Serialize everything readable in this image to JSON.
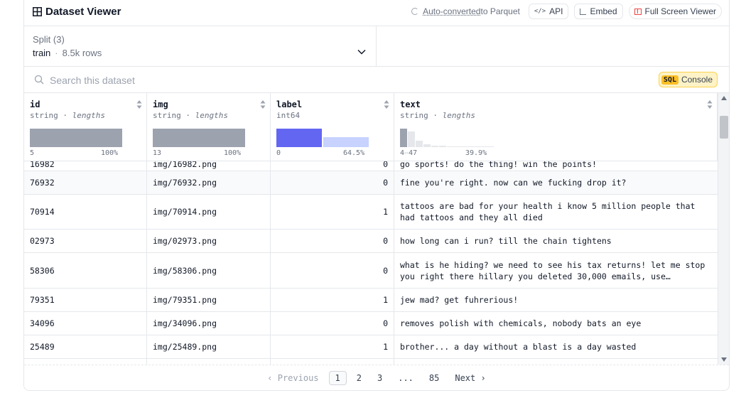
{
  "header": {
    "title": "Dataset Viewer",
    "auto_converted": "Auto-converted",
    "to_parquet": " to Parquet",
    "api_label": "API",
    "embed_label": "Embed",
    "full_screen_label": "Full Screen Viewer"
  },
  "split": {
    "label": "Split (3)",
    "value": "train",
    "rows": "8.5k rows"
  },
  "search": {
    "placeholder": "Search this dataset"
  },
  "sql": {
    "tag": "SQL",
    "label": "Console"
  },
  "columns": [
    {
      "name": "id",
      "type": "string",
      "type_extra": "lengths",
      "min": "5",
      "max": "100%"
    },
    {
      "name": "img",
      "type": "string",
      "type_extra": "lengths",
      "min": "13",
      "max": "100%"
    },
    {
      "name": "label",
      "type": "int64",
      "type_extra": "",
      "min": "0",
      "max": "64.5%"
    },
    {
      "name": "text",
      "type": "string",
      "type_extra": "lengths",
      "min": "4",
      "min_suffix": "47",
      "max": "39.9%"
    }
  ],
  "rows": [
    {
      "id": "16982",
      "img": "img/16982.png",
      "label": "0",
      "text": "go sports! do the thing! win the points!"
    },
    {
      "id": "76932",
      "img": "img/76932.png",
      "label": "0",
      "text": "fine you're right. now can we fucking drop it?"
    },
    {
      "id": "70914",
      "img": "img/70914.png",
      "label": "1",
      "text": "tattoos are bad for your health i know 5 million people that had tattoos and they all died"
    },
    {
      "id": "02973",
      "img": "img/02973.png",
      "label": "0",
      "text": "how long can i run? till the chain tightens"
    },
    {
      "id": "58306",
      "img": "img/58306.png",
      "label": "0",
      "text": "what is he hiding? we need to see his tax returns! let me stop you right there hillary you deleted 30,000 emails, use…"
    },
    {
      "id": "79351",
      "img": "img/79351.png",
      "label": "1",
      "text": "jew mad? get fuhrerious!"
    },
    {
      "id": "34096",
      "img": "img/34096.png",
      "label": "0",
      "text": "removes polish with chemicals, nobody bats an eye"
    },
    {
      "id": "25489",
      "img": "img/25489.png",
      "label": "1",
      "text": "brother... a day without a blast is a day wasted"
    }
  ],
  "pagination": {
    "previous": "‹ Previous",
    "pages": [
      "1",
      "2",
      "3",
      "...",
      "85"
    ],
    "next": "Next ›",
    "current": "1"
  },
  "colors": {
    "accent_histogram": "#6366f1",
    "accent_histogram_light": "#c7d2fe",
    "histogram_gray": "#9ca3af",
    "sql_tag": "#fbbf24",
    "full_screen_icon": "#ef4444"
  },
  "icons": {
    "title": "table-grid-icon",
    "auto_converted": "spinner-icon",
    "api": "code-icon",
    "embed": "embed-icon",
    "full_screen": "fullscreen-icon",
    "split": "chevron-down-icon",
    "search": "search-icon",
    "sort": "sort-icon"
  }
}
